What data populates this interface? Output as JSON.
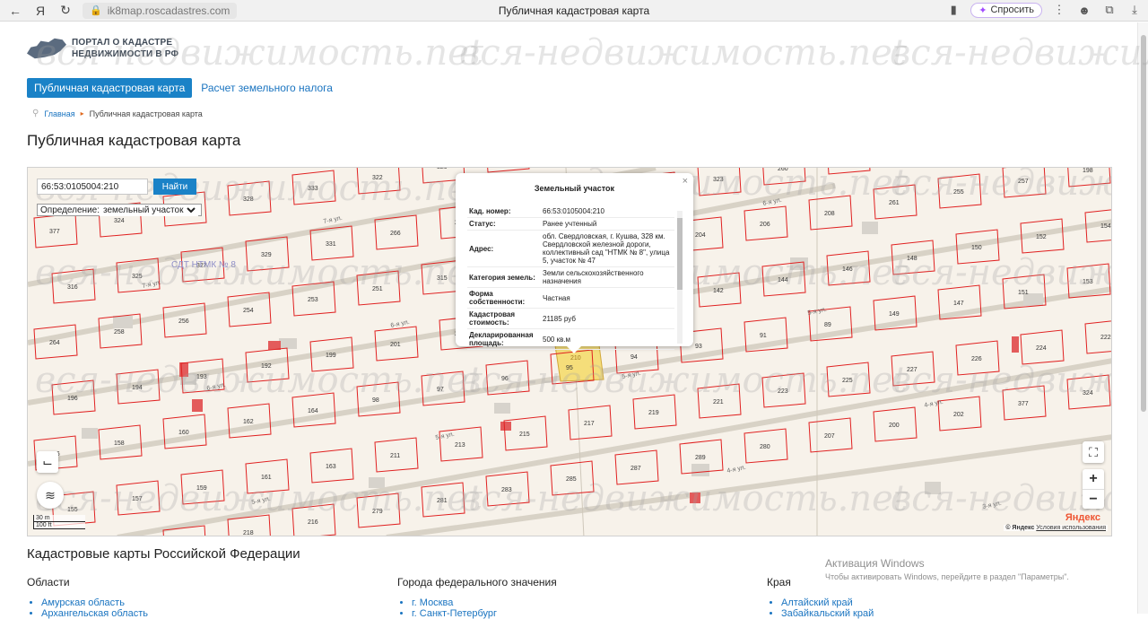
{
  "browser": {
    "url": "ik8map.roscadastres.com",
    "tab_title": "Публичная кадастровая карта",
    "ask_label": "Спросить"
  },
  "site": {
    "logo_line1": "ПОРТАЛ О КАДАСТРЕ",
    "logo_line2": "НЕДВИЖИМОСТИ В РФ",
    "watermark": "вся-недвижимость.net"
  },
  "nav": {
    "tab_active": "Публичная кадастровая карта",
    "tab_tax": "Расчет земельного налога"
  },
  "breadcrumb": {
    "home": "Главная",
    "current": "Публичная кадастровая карта"
  },
  "page_title": "Публичная кадастровая карта",
  "map": {
    "search_value": "66:53:0105004:210",
    "search_button": "Найти",
    "definition_label": "Определение:",
    "definition_value": "земельный участок",
    "scale_m": "30 m",
    "scale_ft": "100 ft",
    "yandex": "Яндекс",
    "copyright_prefix": "© Яндекс",
    "terms_link": "Условия использования",
    "garden_label": "СДТ НТМК № 8",
    "selected_parcel": "210"
  },
  "popup": {
    "title": "Земельный участок",
    "rows": [
      {
        "k": "Кад. номер:",
        "v": "66:53:0105004:210"
      },
      {
        "k": "Статус:",
        "v": "Ранее учтенный"
      },
      {
        "k": "Адрес:",
        "v": "обл. Свердловская, г. Кушва, 328 км. Свердловской железной дороги, коллективный сад \"НТМК № 8\", улица 5, участок № 47"
      },
      {
        "k": "Категория земель:",
        "v": "Земли сельскохозяйственного назначения"
      },
      {
        "k": "Форма собственности:",
        "v": "Частная"
      },
      {
        "k": "Кадастровая стоимость:",
        "v": "21185 руб"
      },
      {
        "k": "Декларированная площадь:",
        "v": "500 кв.м"
      }
    ]
  },
  "sections": {
    "title": "Кадастровые карты Российской Федерации",
    "regions_title": "Области",
    "regions": [
      "Амурская область",
      "Архангельская область"
    ],
    "federal_title": "Города федерального значения",
    "federal": [
      "г. Москва",
      "г. Санкт-Петербург"
    ],
    "krai_title": "Края",
    "krai": [
      "Алтайский край",
      "Забайкальский край"
    ]
  },
  "activation": {
    "line1": "Активация Windows",
    "line2": "Чтобы активировать Windows, перейдите в раздел \"Параметры\"."
  }
}
